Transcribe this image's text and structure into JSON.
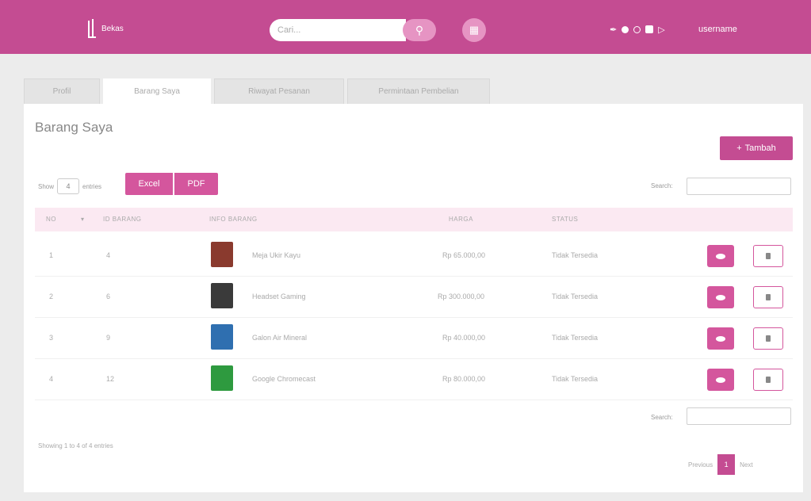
{
  "header": {
    "logo_text": "Bekas",
    "search_placeholder": "Cari...",
    "username": "username"
  },
  "tabs": [
    {
      "label": "Profil",
      "active": false
    },
    {
      "label": "Barang Saya",
      "active": true
    },
    {
      "label": "Riwayat Pesanan",
      "active": false
    },
    {
      "label": "Permintaan Pembelian",
      "active": false
    }
  ],
  "page": {
    "title": "Barang Saya",
    "add_label": "Tambah",
    "show_label": "Show",
    "entries_value": "4",
    "entries_label": "entries",
    "excel_label": "Excel",
    "pdf_label": "PDF",
    "search_label": "Search:"
  },
  "table": {
    "columns": [
      "NO",
      "ID BARANG",
      "INFO BARANG",
      "HARGA",
      "STATUS"
    ],
    "rows": [
      {
        "no": "1",
        "id": "4",
        "name": "Meja Ukir Kayu",
        "price": "Rp 65.000,00",
        "status": "Tidak Tersedia",
        "thumb_color": "#8a3a2e"
      },
      {
        "no": "2",
        "id": "6",
        "name": "Headset Gaming",
        "price": "Rp 300.000,00",
        "status": "Tidak Tersedia",
        "thumb_color": "#3a3a3a"
      },
      {
        "no": "3",
        "id": "9",
        "name": "Galon Air Mineral",
        "price": "Rp 40.000,00",
        "status": "Tidak Tersedia",
        "thumb_color": "#2f6fb0"
      },
      {
        "no": "4",
        "id": "12",
        "name": "Google Chromecast",
        "price": "Rp 80.000,00",
        "status": "Tidak Tersedia",
        "thumb_color": "#2e9a3f"
      }
    ]
  },
  "footer": {
    "showing": "Showing 1 to 4 of 4 entries",
    "prev": "Previous",
    "current_page": "1",
    "next": "Next"
  },
  "colors": {
    "brand": "#c44c92",
    "accent": "#d4569d"
  }
}
